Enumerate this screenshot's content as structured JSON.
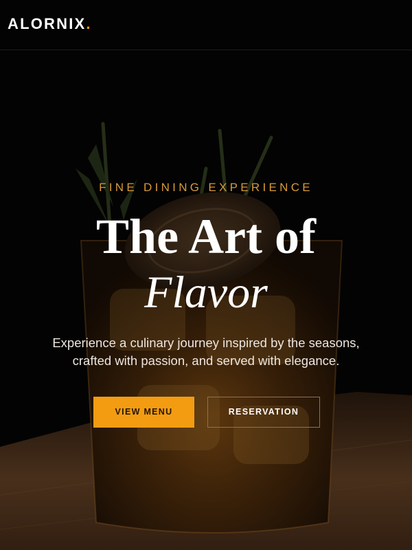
{
  "header": {
    "logo_text": "ALORNIX",
    "logo_dot": "."
  },
  "hero": {
    "eyebrow": "FINE DINING EXPERIENCE",
    "title_line1": "The Art of",
    "title_line2": "Flavor",
    "tagline_line1": "Experience a culinary journey inspired by the seasons,",
    "tagline_line2": "crafted with passion, and served with elegance.",
    "primary_button": "VIEW MENU",
    "secondary_button": "RESERVATION",
    "background_image": "cocktail-glass-with-herbs"
  },
  "colors": {
    "accent": "#f39c12",
    "background": "#050404",
    "eyebrow": "#d89a3a",
    "text": "#ffffff"
  }
}
